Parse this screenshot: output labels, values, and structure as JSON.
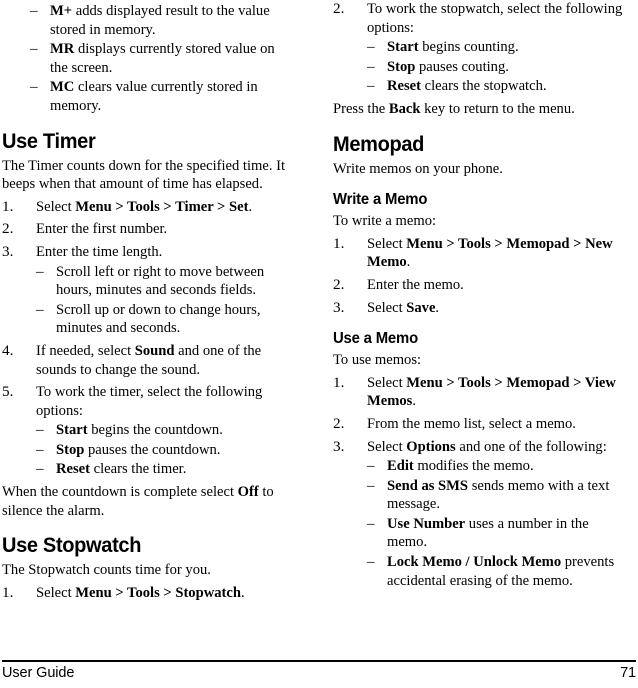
{
  "document": {
    "footer_left": "User Guide",
    "footer_page": "71"
  },
  "left_column": {
    "memory_keys": [
      {
        "term": "M+",
        "rest": " adds displayed result to the value stored in memory."
      },
      {
        "term": "MR",
        "rest": " displays currently stored value on the screen."
      },
      {
        "term": "MC",
        "rest": " clears value currently stored in memory."
      }
    ],
    "use_timer": {
      "heading": "Use Timer",
      "intro": "The Timer counts down for the specified time. It beeps when that amount of time has elapsed.",
      "steps": [
        {
          "num": "1.",
          "pre": "Select ",
          "bold": "Menu > Tools > Timer > Set",
          "post": "."
        },
        {
          "num": "2.",
          "pre": "Enter the first number.",
          "bold": "",
          "post": ""
        },
        {
          "num": "3.",
          "pre": "Enter the time length.",
          "bold": "",
          "post": "",
          "sub": [
            {
              "term": "",
              "rest": "Scroll left or right to move between hours, minutes and seconds fields."
            },
            {
              "term": "",
              "rest": "Scroll up or down to change hours, minutes and seconds."
            }
          ]
        },
        {
          "num": "4.",
          "pre": "If needed, select ",
          "bold": "Sound",
          "post": " and one of the sounds to change the sound."
        },
        {
          "num": "5.",
          "pre": "To work the timer, select the following options:",
          "bold": "",
          "post": "",
          "sub": [
            {
              "term": "Start",
              "rest": " begins the countdown."
            },
            {
              "term": "Stop",
              "rest": " pauses the countdown."
            },
            {
              "term": "Reset",
              "rest": " clears the timer."
            }
          ]
        }
      ],
      "closing_pre": "When the countdown is complete select ",
      "closing_bold": "Off",
      "closing_post": " to silence the alarm."
    },
    "use_stopwatch": {
      "heading": "Use Stopwatch",
      "intro": "The Stopwatch counts time for you.",
      "steps": [
        {
          "num": "1.",
          "pre": "Select ",
          "bold": "Menu > Tools > Stopwatch",
          "post": "."
        }
      ]
    }
  },
  "right_column": {
    "stopwatch_cont": {
      "steps": [
        {
          "num": "2.",
          "pre": "To work the stopwatch, select the following options:",
          "bold": "",
          "post": "",
          "sub": [
            {
              "term": "Start",
              "rest": " begins counting."
            },
            {
              "term": "Stop",
              "rest": " pauses couting."
            },
            {
              "term": "Reset",
              "rest": " clears the stopwatch."
            }
          ]
        }
      ],
      "closing_pre": "Press the ",
      "closing_bold": "Back",
      "closing_post": " key to return to the menu."
    },
    "memopad": {
      "heading": "Memopad",
      "intro": "Write memos on your phone."
    },
    "write_memo": {
      "heading": "Write a Memo",
      "intro": "To write a memo:",
      "steps": [
        {
          "num": "1.",
          "pre": "Select ",
          "bold": "Menu > Tools > Memopad > New Memo",
          "post": "."
        },
        {
          "num": "2.",
          "pre": "Enter the memo.",
          "bold": "",
          "post": ""
        },
        {
          "num": "3.",
          "pre": "Select ",
          "bold": "Save",
          "post": "."
        }
      ]
    },
    "use_memo": {
      "heading": "Use a Memo",
      "intro": "To use memos:",
      "steps": [
        {
          "num": "1.",
          "pre": "Select ",
          "bold": "Menu > Tools > Memopad > View Memos",
          "post": "."
        },
        {
          "num": "2.",
          "pre": "From the memo list, select a memo.",
          "bold": "",
          "post": ""
        },
        {
          "num": "3.",
          "pre": "Select ",
          "bold": "Options",
          "post": " and one of the following:",
          "sub": [
            {
              "term": "Edit",
              "rest": " modifies the memo."
            },
            {
              "term": "Send as SMS",
              "rest": " sends memo with a text message."
            },
            {
              "term": "Use Number",
              "rest": " uses a number in the memo."
            },
            {
              "term": "Lock Memo / Unlock Memo",
              "rest": " prevents accidental erasing of the memo."
            }
          ]
        }
      ]
    }
  },
  "glyphs": {
    "dash": "–"
  }
}
